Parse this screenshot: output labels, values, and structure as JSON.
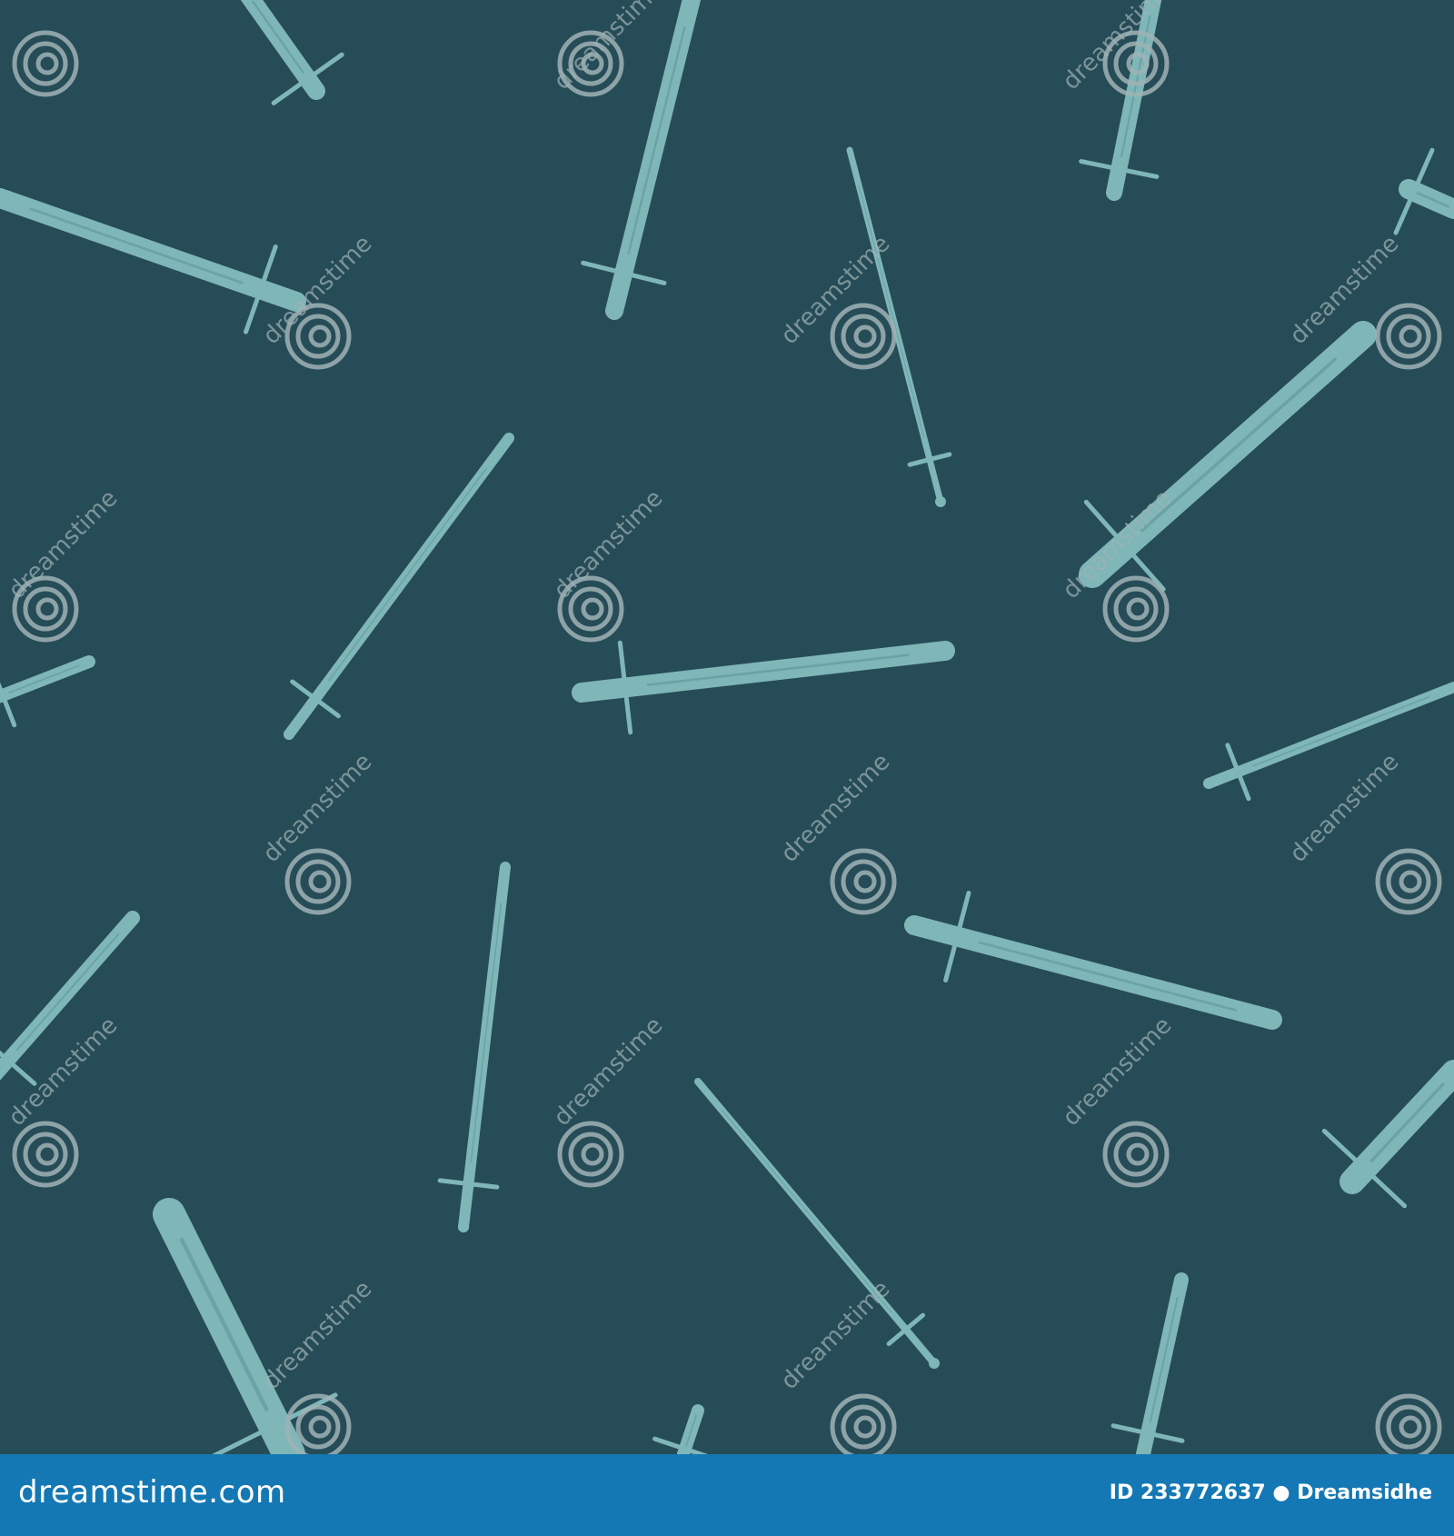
{
  "image": {
    "background_color": "#264c57",
    "sword_color": "#7fb6b8",
    "watermark_color": "#9fb3b5",
    "subject": "seamless pattern of scattered sword icons"
  },
  "watermark": {
    "text": "dreamstime",
    "icon": "spiral-logo-icon"
  },
  "footer": {
    "background_color": "#1478b4",
    "site": "dreamstime.com",
    "id_label": "ID 233772637",
    "author": "Dreamsidhe"
  }
}
